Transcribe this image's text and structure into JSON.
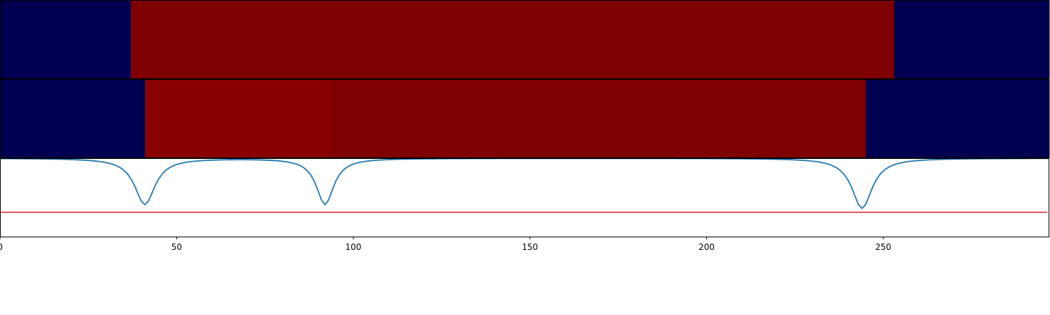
{
  "colors": {
    "low": "#000050",
    "high": "#7e0000",
    "high_alt": "#880000",
    "line": "#1f77b4",
    "threshold": "#d62728",
    "axis": "#000000"
  },
  "chart_data": [
    {
      "type": "heatmap",
      "x_domain": [
        0,
        297
      ],
      "segments": [
        {
          "start": 0,
          "end": 37,
          "state": "low"
        },
        {
          "start": 37,
          "end": 253,
          "state": "high"
        },
        {
          "start": 253,
          "end": 297,
          "state": "low"
        }
      ]
    },
    {
      "type": "heatmap",
      "x_domain": [
        0,
        297
      ],
      "segments": [
        {
          "start": 0,
          "end": 41,
          "state": "low"
        },
        {
          "start": 41,
          "end": 93,
          "state": "high_alt"
        },
        {
          "start": 93,
          "end": 245,
          "state": "high"
        },
        {
          "start": 245,
          "end": 297,
          "state": "low"
        }
      ]
    },
    {
      "type": "line",
      "xlim": [
        0,
        297
      ],
      "ylim": [
        0,
        1
      ],
      "x_ticks": [
        0,
        50,
        100,
        150,
        200,
        250
      ],
      "x_tick_labels": [
        "0",
        "50",
        "100",
        "150",
        "200",
        "250"
      ],
      "threshold": 0.31,
      "dips": [
        {
          "center": 41,
          "depth": 0.59,
          "width": 3.5
        },
        {
          "center": 92,
          "depth": 0.59,
          "width": 3.0
        },
        {
          "center": 244,
          "depth": 0.64,
          "width": 3.5
        }
      ],
      "baseline": 1.0
    }
  ]
}
